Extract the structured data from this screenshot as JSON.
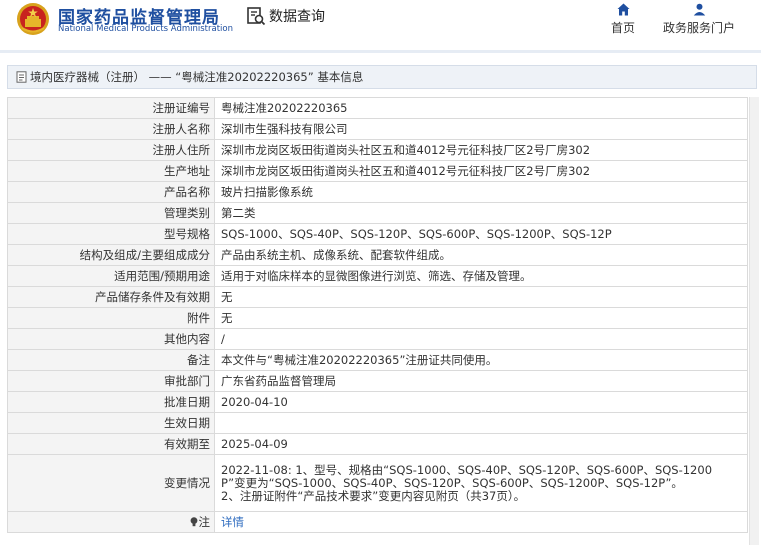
{
  "header": {
    "brand_cn": "国家药品监督管理局",
    "brand_en": "National Medical Products Administration",
    "query_label": "数据查询",
    "nav": [
      {
        "label": "首页",
        "icon": "home-icon"
      },
      {
        "label": "政务服务门户",
        "icon": "user-icon"
      }
    ]
  },
  "breadcrumb": {
    "text": "境内医疗器械（注册） —— “粤械注准20202220365” 基本信息",
    "icon": "document-icon"
  },
  "fields": [
    {
      "label": "注册证编号",
      "value": "粤械注准20202220365"
    },
    {
      "label": "注册人名称",
      "value": "深圳市生强科技有限公司"
    },
    {
      "label": "注册人住所",
      "value": "深圳市龙岗区坂田街道岗头社区五和道4012号元征科技厂区2号厂房302"
    },
    {
      "label": "生产地址",
      "value": "深圳市龙岗区坂田街道岗头社区五和道4012号元征科技厂区2号厂房302"
    },
    {
      "label": "产品名称",
      "value": "玻片扫描影像系统"
    },
    {
      "label": "管理类别",
      "value": "第二类"
    },
    {
      "label": "型号规格",
      "value": "SQS-1000、SQS-40P、SQS-120P、SQS-600P、SQS-1200P、SQS-12P"
    },
    {
      "label": "结构及组成/主要组成成分",
      "value": "产品由系统主机、成像系统、配套软件组成。"
    },
    {
      "label": "适用范围/预期用途",
      "value": "适用于对临床样本的显微图像进行浏览、筛选、存储及管理。"
    },
    {
      "label": "产品储存条件及有效期",
      "value": "无"
    },
    {
      "label": "附件",
      "value": "无"
    },
    {
      "label": "其他内容",
      "value": "/"
    },
    {
      "label": "备注",
      "value": "本文件与“粤械注准20202220365”注册证共同使用。"
    },
    {
      "label": "审批部门",
      "value": "广东省药品监督管理局"
    },
    {
      "label": "批准日期",
      "value": "2020-04-10"
    },
    {
      "label": "生效日期",
      "value": ""
    },
    {
      "label": "有效期至",
      "value": "2025-04-09"
    }
  ],
  "change": {
    "label": "变更情况",
    "lines": [
      "2022-11-08: 1、型号、规格由“SQS-1000、SQS-40P、SQS-120P、SQS-600P、SQS-1200",
      "P”变更为“SQS-1000、SQS-40P、SQS-120P、SQS-600P、SQS-1200P、SQS-12P”。",
      "2、注册证附件“产品技术要求”变更内容见附页（共37页）。"
    ]
  },
  "note": {
    "label": "注",
    "link": "详情",
    "icon": "bulb-icon"
  }
}
